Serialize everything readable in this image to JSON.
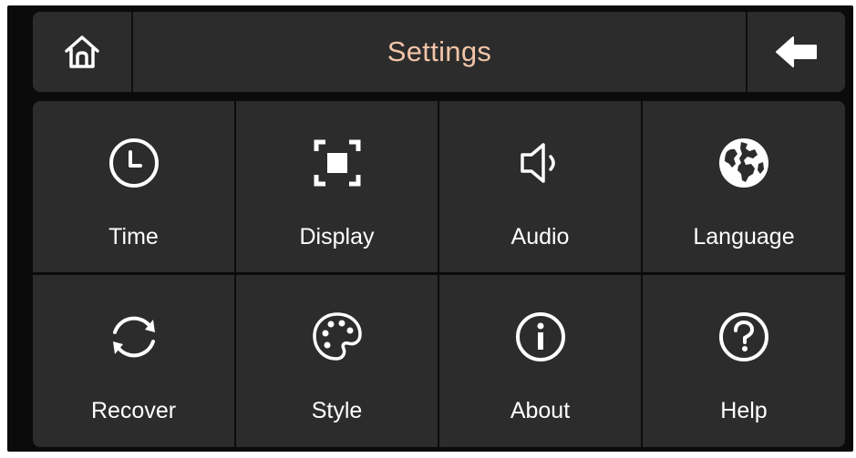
{
  "header": {
    "title": "Settings",
    "home_icon": "home-icon",
    "back_icon": "back-arrow-icon"
  },
  "tiles": [
    {
      "label": "Time",
      "icon": "clock-icon"
    },
    {
      "label": "Display",
      "icon": "display-icon"
    },
    {
      "label": "Audio",
      "icon": "speaker-icon"
    },
    {
      "label": "Language",
      "icon": "globe-icon"
    },
    {
      "label": "Recover",
      "icon": "refresh-icon"
    },
    {
      "label": "Style",
      "icon": "palette-icon"
    },
    {
      "label": "About",
      "icon": "info-icon"
    },
    {
      "label": "Help",
      "icon": "help-icon"
    }
  ],
  "colors": {
    "background": "#0b0b0b",
    "panel": "#2c2c2c",
    "title": "#f2c4a8",
    "text": "#ffffff"
  }
}
